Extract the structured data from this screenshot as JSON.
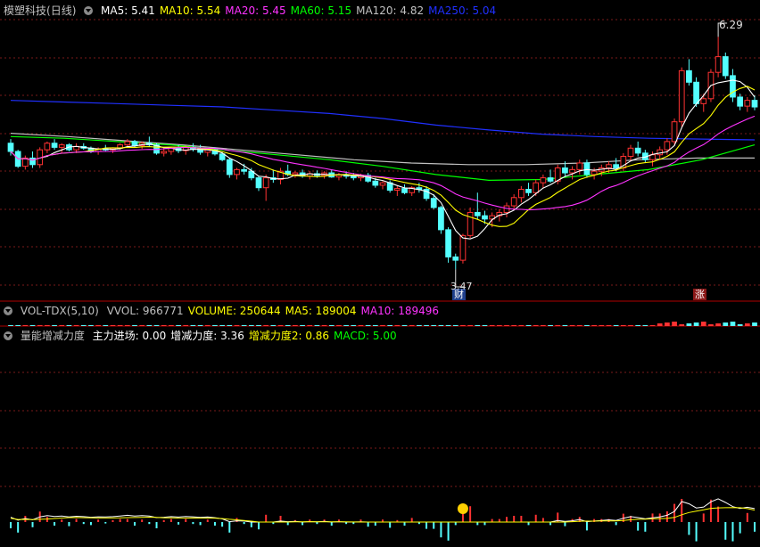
{
  "main_panel": {
    "stock_name": "模塑科技",
    "period": "(日线)",
    "indicators": [
      {
        "label": "MA5:",
        "value": "5.41",
        "color": "#ffffff"
      },
      {
        "label": "MA10:",
        "value": "5.54",
        "color": "#ffff00"
      },
      {
        "label": "MA20:",
        "value": "5.45",
        "color": "#ff33ff"
      },
      {
        "label": "MA60:",
        "value": "5.15",
        "color": "#00ff00"
      },
      {
        "label": "MA120:",
        "value": "4.82",
        "color": "#c0c0c0"
      },
      {
        "label": "MA250:",
        "value": "5.04",
        "color": "#2030ff"
      }
    ],
    "high_label": "6.29",
    "low_label": "3.47",
    "badge_cai": "财",
    "badge_zhang": "涨"
  },
  "vol_panel": {
    "title": "VOL-TDX(5,10)",
    "indicators": [
      {
        "label": "VVOL:",
        "value": "966771",
        "color": "#c0c0c0"
      },
      {
        "label": "VOLUME:",
        "value": "250644",
        "color": "#ffff00"
      },
      {
        "label": "MA5:",
        "value": "189004",
        "color": "#ffff00"
      },
      {
        "label": "MA10:",
        "value": "189496",
        "color": "#ff33ff"
      }
    ]
  },
  "ind_panel": {
    "title": "量能增减力度",
    "indicators": [
      {
        "label": "主力进场:",
        "value": "0.00",
        "color": "#ffffff"
      },
      {
        "label": "增减力度:",
        "value": "3.36",
        "color": "#ffffff"
      },
      {
        "label": "增减力度2:",
        "value": "0.86",
        "color": "#ffff00"
      },
      {
        "label": "MACD:",
        "value": "5.00",
        "color": "#00ff00"
      }
    ]
  },
  "colors": {
    "up": "#ff3232",
    "down": "#54ffff",
    "grid": "#7a1a1a"
  },
  "chart_data": {
    "type": "candlestick",
    "ylim": [
      3.3,
      6.5
    ],
    "candles": [
      [
        5.0,
        5.05,
        4.85,
        4.9
      ],
      [
        4.9,
        4.92,
        4.7,
        4.72
      ],
      [
        4.72,
        4.85,
        4.68,
        4.82
      ],
      [
        4.82,
        4.9,
        4.7,
        4.74
      ],
      [
        4.74,
        4.95,
        4.7,
        4.92
      ],
      [
        4.92,
        5.02,
        4.88,
        5.0
      ],
      [
        5.0,
        5.05,
        4.92,
        4.95
      ],
      [
        4.95,
        5.0,
        4.88,
        4.98
      ],
      [
        4.98,
        5.0,
        4.9,
        4.92
      ],
      [
        4.92,
        5.0,
        4.88,
        4.96
      ],
      [
        4.96,
        5.0,
        4.92,
        4.94
      ],
      [
        4.94,
        4.96,
        4.88,
        4.9
      ],
      [
        4.9,
        4.95,
        4.86,
        4.93
      ],
      [
        4.93,
        4.98,
        4.9,
        4.92
      ],
      [
        4.92,
        4.95,
        4.88,
        4.94
      ],
      [
        4.94,
        5.0,
        4.92,
        4.98
      ],
      [
        4.98,
        5.05,
        4.95,
        5.02
      ],
      [
        5.02,
        5.04,
        4.95,
        4.97
      ],
      [
        4.97,
        5.02,
        4.93,
        5.0
      ],
      [
        5.0,
        5.08,
        4.96,
        4.98
      ],
      [
        4.98,
        5.0,
        4.86,
        4.88
      ],
      [
        4.88,
        4.95,
        4.84,
        4.9
      ],
      [
        4.9,
        4.96,
        4.86,
        4.94
      ],
      [
        4.94,
        4.98,
        4.88,
        4.91
      ],
      [
        4.91,
        4.97,
        4.86,
        4.95
      ],
      [
        4.95,
        5.0,
        4.9,
        4.93
      ],
      [
        4.93,
        4.98,
        4.86,
        4.89
      ],
      [
        4.89,
        4.94,
        4.84,
        4.92
      ],
      [
        4.92,
        4.95,
        4.85,
        4.87
      ],
      [
        4.87,
        4.9,
        4.78,
        4.8
      ],
      [
        4.8,
        4.82,
        4.58,
        4.62
      ],
      [
        4.62,
        4.7,
        4.56,
        4.68
      ],
      [
        4.68,
        4.75,
        4.62,
        4.66
      ],
      [
        4.66,
        4.7,
        4.55,
        4.58
      ],
      [
        4.58,
        4.6,
        4.42,
        4.46
      ],
      [
        4.46,
        4.62,
        4.3,
        4.58
      ],
      [
        4.58,
        4.68,
        4.52,
        4.56
      ],
      [
        4.56,
        4.7,
        4.5,
        4.66
      ],
      [
        4.66,
        4.74,
        4.6,
        4.62
      ],
      [
        4.62,
        4.66,
        4.58,
        4.64
      ],
      [
        4.64,
        4.68,
        4.58,
        4.6
      ],
      [
        4.6,
        4.66,
        4.56,
        4.63
      ],
      [
        4.63,
        4.67,
        4.58,
        4.61
      ],
      [
        4.61,
        4.66,
        4.57,
        4.64
      ],
      [
        4.64,
        4.68,
        4.58,
        4.59
      ],
      [
        4.59,
        4.64,
        4.55,
        4.62
      ],
      [
        4.62,
        4.66,
        4.57,
        4.6
      ],
      [
        4.6,
        4.64,
        4.55,
        4.58
      ],
      [
        4.58,
        4.63,
        4.54,
        4.61
      ],
      [
        4.61,
        4.64,
        4.52,
        4.54
      ],
      [
        4.54,
        4.58,
        4.46,
        4.49
      ],
      [
        4.49,
        4.54,
        4.44,
        4.52
      ],
      [
        4.52,
        4.55,
        4.4,
        4.43
      ],
      [
        4.43,
        4.48,
        4.36,
        4.45
      ],
      [
        4.45,
        4.5,
        4.38,
        4.4
      ],
      [
        4.4,
        4.48,
        4.36,
        4.46
      ],
      [
        4.46,
        4.52,
        4.4,
        4.44
      ],
      [
        4.44,
        4.48,
        4.3,
        4.33
      ],
      [
        4.33,
        4.38,
        4.2,
        4.22
      ],
      [
        4.22,
        4.24,
        3.9,
        3.95
      ],
      [
        3.95,
        3.98,
        3.55,
        3.62
      ],
      [
        3.62,
        3.66,
        3.47,
        3.58
      ],
      [
        3.58,
        3.9,
        3.54,
        3.88
      ],
      [
        3.88,
        4.22,
        3.85,
        4.16
      ],
      [
        4.16,
        4.4,
        4.08,
        4.12
      ],
      [
        4.12,
        4.18,
        4.02,
        4.08
      ],
      [
        4.08,
        4.16,
        3.98,
        4.12
      ],
      [
        4.12,
        4.2,
        4.05,
        4.16
      ],
      [
        4.16,
        4.28,
        4.1,
        4.24
      ],
      [
        4.24,
        4.38,
        4.2,
        4.34
      ],
      [
        4.34,
        4.48,
        4.28,
        4.44
      ],
      [
        4.44,
        4.52,
        4.36,
        4.4
      ],
      [
        4.4,
        4.56,
        4.36,
        4.52
      ],
      [
        4.52,
        4.62,
        4.46,
        4.58
      ],
      [
        4.58,
        4.68,
        4.52,
        4.54
      ],
      [
        4.54,
        4.74,
        4.5,
        4.7
      ],
      [
        4.7,
        4.78,
        4.6,
        4.64
      ],
      [
        4.64,
        4.72,
        4.56,
        4.68
      ],
      [
        4.68,
        4.8,
        4.62,
        4.76
      ],
      [
        4.76,
        4.8,
        4.58,
        4.62
      ],
      [
        4.62,
        4.7,
        4.56,
        4.66
      ],
      [
        4.66,
        4.74,
        4.6,
        4.7
      ],
      [
        4.7,
        4.78,
        4.64,
        4.74
      ],
      [
        4.74,
        4.82,
        4.66,
        4.7
      ],
      [
        4.7,
        4.88,
        4.66,
        4.84
      ],
      [
        4.84,
        4.98,
        4.78,
        4.94
      ],
      [
        4.94,
        5.02,
        4.84,
        4.88
      ],
      [
        4.88,
        4.92,
        4.76,
        4.8
      ],
      [
        4.8,
        4.9,
        4.72,
        4.86
      ],
      [
        4.86,
        4.96,
        4.8,
        4.92
      ],
      [
        4.92,
        5.06,
        4.86,
        5.02
      ],
      [
        5.02,
        5.3,
        4.98,
        5.26
      ],
      [
        5.26,
        5.92,
        5.2,
        5.88
      ],
      [
        5.88,
        6.02,
        5.7,
        5.74
      ],
      [
        5.74,
        5.8,
        5.44,
        5.48
      ],
      [
        5.48,
        5.6,
        5.38,
        5.54
      ],
      [
        5.54,
        5.9,
        5.5,
        5.86
      ],
      [
        5.86,
        6.29,
        5.8,
        6.05
      ],
      [
        6.05,
        6.1,
        5.78,
        5.82
      ],
      [
        5.82,
        5.9,
        5.5,
        5.56
      ],
      [
        5.56,
        5.6,
        5.4,
        5.45
      ],
      [
        5.45,
        5.56,
        5.38,
        5.52
      ],
      [
        5.52,
        5.58,
        5.4,
        5.44
      ]
    ],
    "series": [
      {
        "name": "MA5",
        "color": "#ffffff"
      },
      {
        "name": "MA10",
        "color": "#ffff00"
      },
      {
        "name": "MA20",
        "color": "#ff33ff"
      },
      {
        "name": "MA60",
        "color": "#00ff00"
      },
      {
        "name": "MA120",
        "color": "#c0c0c0"
      },
      {
        "name": "MA250",
        "color": "#2030ff"
      }
    ],
    "ma250_values": [
      5.52,
      5.5,
      5.48,
      5.46,
      5.44,
      5.4,
      5.36,
      5.3,
      5.22,
      5.16,
      5.11,
      5.08,
      5.06,
      5.05,
      5.04
    ],
    "ma120_values": [
      5.12,
      5.08,
      5.03,
      4.98,
      4.92,
      4.86,
      4.8,
      4.76,
      4.74,
      4.74,
      4.76,
      4.8,
      4.82,
      4.82
    ],
    "ma60_values": [
      5.08,
      5.06,
      5.02,
      4.98,
      4.92,
      4.86,
      4.8,
      4.72,
      4.62,
      4.55,
      4.56,
      4.62,
      4.68,
      4.8,
      4.98
    ]
  }
}
